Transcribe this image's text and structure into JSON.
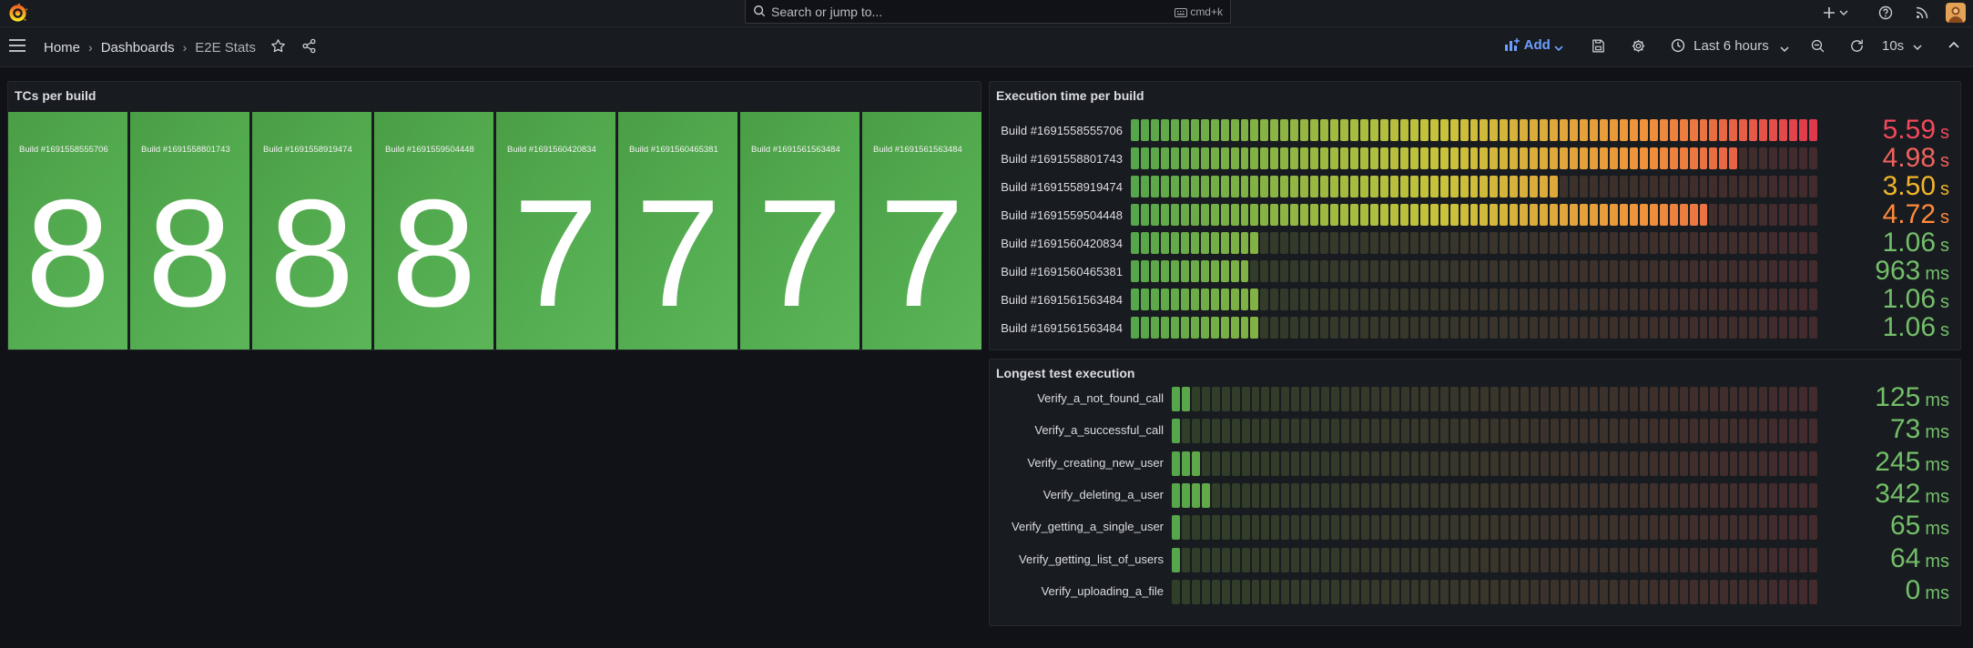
{
  "topbar": {
    "search_placeholder": "Search or jump to...",
    "search_shortcut": "cmd+k",
    "icons": [
      "grafana-logo",
      "search-icon",
      "keyboard-icon",
      "plus-icon",
      "chevron-down-icon",
      "help-icon",
      "news-icon",
      "user-avatar"
    ]
  },
  "navbar": {
    "breadcrumbs": [
      "Home",
      "Dashboards",
      "E2E Stats"
    ],
    "add_label": "Add",
    "time_range": "Last 6 hours",
    "refresh_interval": "10s",
    "icons": [
      "menu-icon",
      "star-icon",
      "share-icon",
      "save-icon",
      "settings-icon",
      "clock-icon",
      "zoom-out-icon",
      "refresh-icon",
      "collapse-icon"
    ]
  },
  "colors": {
    "background": "#111217",
    "panel": "#181b1f",
    "tile_green": "#52a84e",
    "value_green": "#73bf69",
    "value_red": "#f2495c",
    "value_orange": "#ff9830",
    "value_yellow": "#fade2a",
    "accent_blue": "#6e9fff"
  },
  "panels": {
    "tcs_per_build": {
      "title": "TCs per build",
      "tiles": [
        {
          "label": "Build #1691558555706",
          "value": "8"
        },
        {
          "label": "Build #1691558801743",
          "value": "8"
        },
        {
          "label": "Build #1691558919474",
          "value": "8"
        },
        {
          "label": "Build #1691559504448",
          "value": "8"
        },
        {
          "label": "Build #1691560420834",
          "value": "7"
        },
        {
          "label": "Build #1691560465381",
          "value": "7"
        },
        {
          "label": "Build #1691561563484",
          "value": "7"
        },
        {
          "label": "Build #1691561563484",
          "value": "7"
        }
      ]
    },
    "execution_time": {
      "title": "Execution time per build",
      "max_seconds": 5.59,
      "rows": [
        {
          "label": "Build #1691558555706",
          "value": "5.59",
          "unit": "s",
          "seconds": 5.59,
          "color": "#f2495c"
        },
        {
          "label": "Build #1691558801743",
          "value": "4.98",
          "unit": "s",
          "seconds": 4.98,
          "color": "#f2625c"
        },
        {
          "label": "Build #1691558919474",
          "value": "3.50",
          "unit": "s",
          "seconds": 3.5,
          "color": "#f2b52a"
        },
        {
          "label": "Build #1691559504448",
          "value": "4.72",
          "unit": "s",
          "seconds": 4.72,
          "color": "#ff8a3c"
        },
        {
          "label": "Build #1691560420834",
          "value": "1.06",
          "unit": "s",
          "seconds": 1.06,
          "color": "#73bf69"
        },
        {
          "label": "Build #1691560465381",
          "value": "963",
          "unit": "ms",
          "seconds": 0.963,
          "color": "#73bf69"
        },
        {
          "label": "Build #1691561563484",
          "value": "1.06",
          "unit": "s",
          "seconds": 1.06,
          "color": "#73bf69"
        },
        {
          "label": "Build #1691561563484",
          "value": "1.06",
          "unit": "s",
          "seconds": 1.06,
          "color": "#73bf69"
        }
      ]
    },
    "longest_test": {
      "title": "Longest test execution",
      "max_ms": 5000,
      "rows": [
        {
          "label": "Verify_a_not_found_call",
          "value": "125",
          "unit": "ms",
          "ms": 125,
          "color": "#73bf69"
        },
        {
          "label": "Verify_a_successful_call",
          "value": "73",
          "unit": "ms",
          "ms": 73,
          "color": "#73bf69"
        },
        {
          "label": "Verify_creating_new_user",
          "value": "245",
          "unit": "ms",
          "ms": 245,
          "color": "#73bf69"
        },
        {
          "label": "Verify_deleting_a_user",
          "value": "342",
          "unit": "ms",
          "ms": 342,
          "color": "#73bf69"
        },
        {
          "label": "Verify_getting_a_single_user",
          "value": "65",
          "unit": "ms",
          "ms": 65,
          "color": "#73bf69"
        },
        {
          "label": "Verify_getting_list_of_users",
          "value": "64",
          "unit": "ms",
          "ms": 64,
          "color": "#73bf69"
        },
        {
          "label": "Verify_uploading_a_file",
          "value": "0",
          "unit": "ms",
          "ms": 0,
          "color": "#73bf69"
        }
      ]
    }
  }
}
